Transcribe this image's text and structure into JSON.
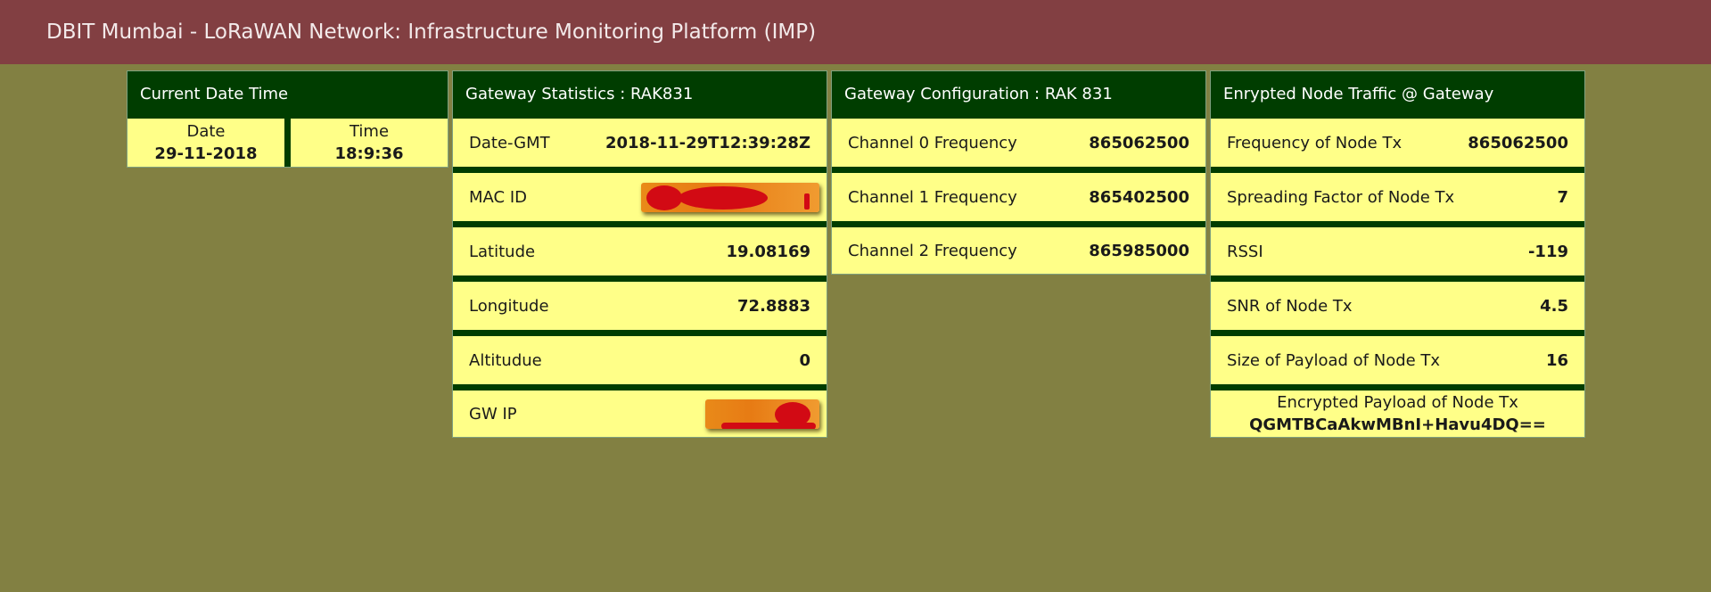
{
  "header": {
    "title": "DBIT Mumbai - LoRaWAN Network: Infrastructure Monitoring Platform (IMP)"
  },
  "datetime": {
    "title": "Current Date Time",
    "date_label": "Date",
    "date_value": "29-11-2018",
    "time_label": "Time",
    "time_value": "18:9:36"
  },
  "gateway_stats": {
    "title": "Gateway Statistics : RAK831",
    "rows": [
      {
        "label": "Date-GMT",
        "value": "2018-11-29T12:39:28Z"
      },
      {
        "label": "MAC ID",
        "value": ""
      },
      {
        "label": "Latitude",
        "value": "19.08169"
      },
      {
        "label": "Longitude",
        "value": "72.8883"
      },
      {
        "label": "Altitudue",
        "value": "0"
      },
      {
        "label": "GW IP",
        "value": ""
      }
    ]
  },
  "gateway_config": {
    "title": "Gateway Configuration : RAK 831",
    "rows": [
      {
        "label": "Channel 0 Frequency",
        "value": "865062500"
      },
      {
        "label": "Channel 1 Frequency",
        "value": "865402500"
      },
      {
        "label": "Channel 2 Frequency",
        "value": "865985000"
      }
    ]
  },
  "node_traffic": {
    "title": "Enrypted Node Traffic @ Gateway",
    "rows": [
      {
        "label": "Frequency of Node Tx",
        "value": "865062500"
      },
      {
        "label": "Spreading Factor of Node Tx",
        "value": "7"
      },
      {
        "label": "RSSI",
        "value": "-119"
      },
      {
        "label": "SNR of Node Tx",
        "value": "4.5"
      },
      {
        "label": "Size of Payload of Node Tx",
        "value": "16"
      }
    ],
    "payload_label": "Encrypted Payload of Node Tx",
    "payload_value": "QGMTBCaAkwMBnI+Havu4DQ=="
  },
  "colors": {
    "header_bg": "#823f42",
    "page_bg": "#828042",
    "panel_title_bg": "#003d00",
    "row_bg": "#ffff88",
    "redaction": "#d20a14"
  }
}
